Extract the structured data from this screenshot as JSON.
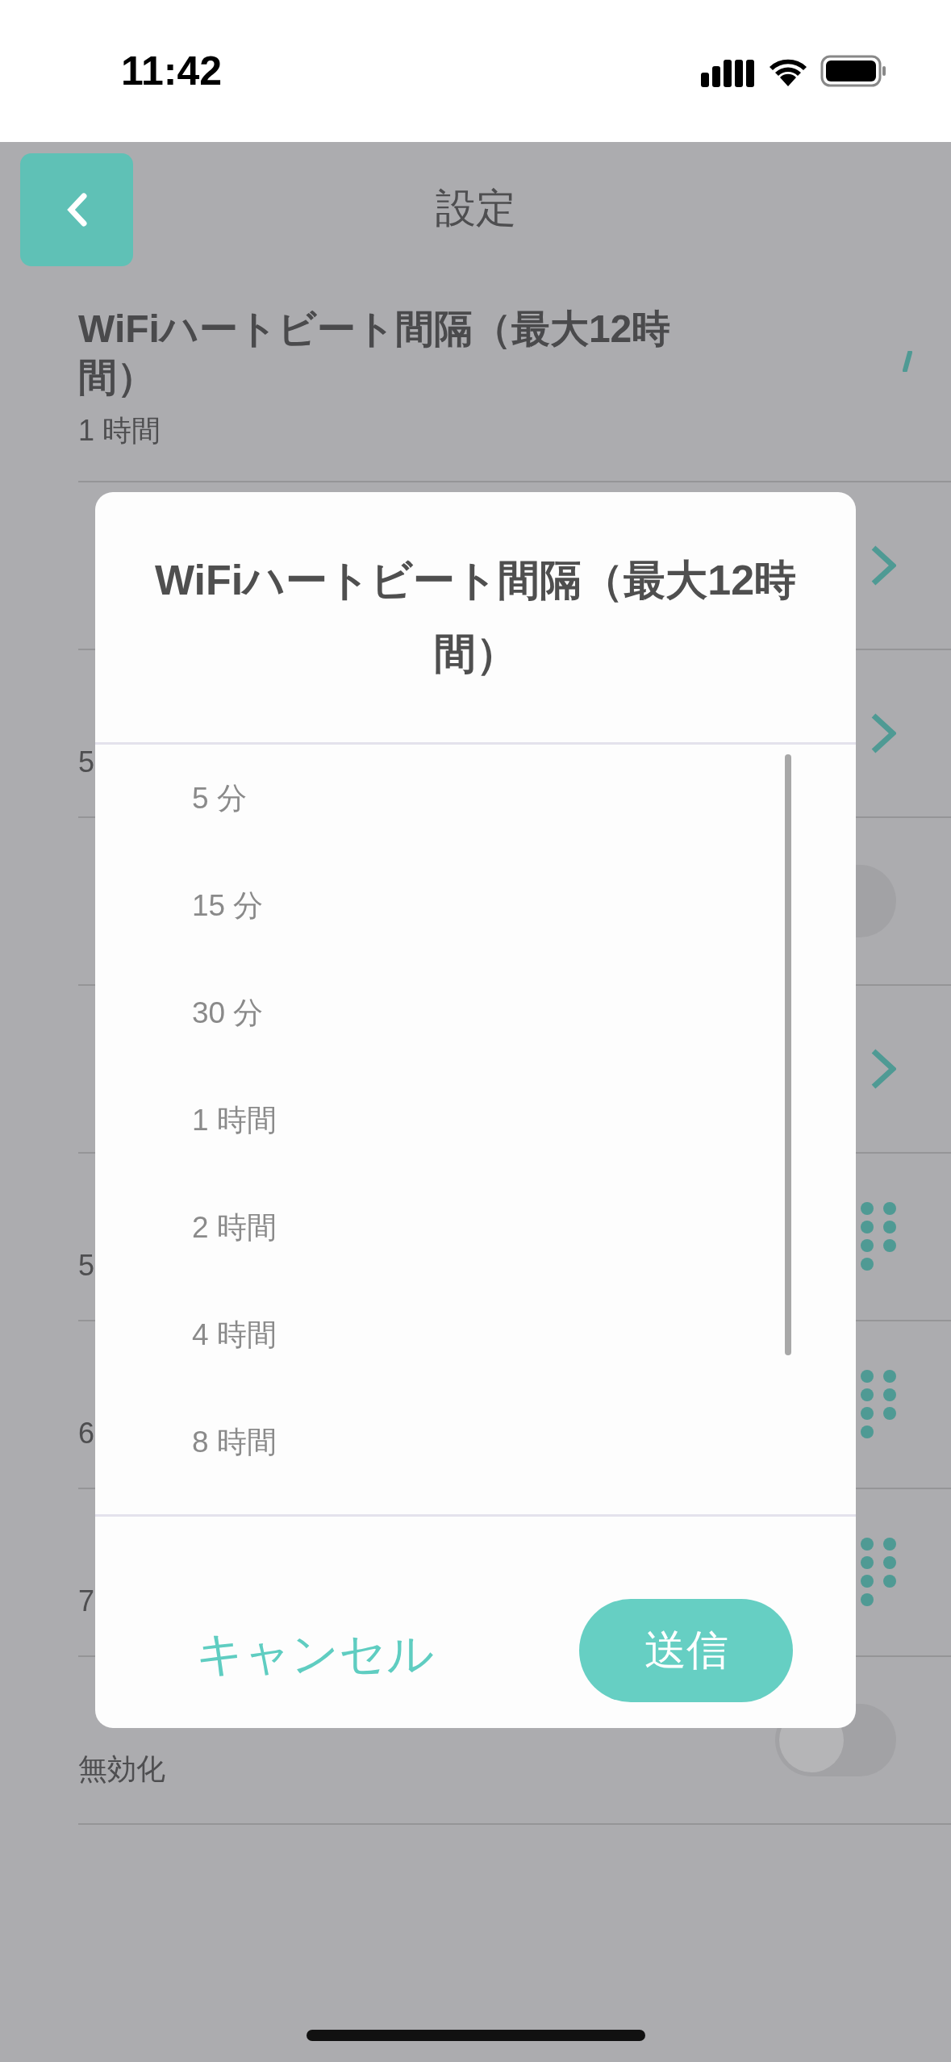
{
  "status_bar": {
    "time": "11:42"
  },
  "header": {
    "title": "設定"
  },
  "settings": [
    {
      "title": "WiFiハートビート間隔（最大12時間）",
      "value": "1 時間",
      "kind": "spinner"
    },
    {
      "kind": "chevron"
    },
    {
      "value": "5",
      "kind": "chevron"
    },
    {
      "kind": "toggle",
      "on": false
    },
    {
      "kind": "chevron"
    },
    {
      "value": "5",
      "kind": "dots"
    },
    {
      "value": "6",
      "kind": "dots"
    },
    {
      "value": "7",
      "kind": "dots"
    },
    {
      "value": "無効化",
      "kind": "toggle",
      "on": false
    }
  ],
  "dialog": {
    "title": "WiFiハートビート間隔（最大12時間）",
    "options": [
      {
        "label": "5 分"
      },
      {
        "label": "15 分"
      },
      {
        "label": "30 分"
      },
      {
        "label": "1 時間"
      },
      {
        "label": "2 時間"
      },
      {
        "label": "4 時間"
      },
      {
        "label": "8 時間"
      }
    ],
    "buttons": [
      {
        "label": "キャンセル",
        "kind": "text"
      },
      {
        "label": "送信",
        "kind": "filled"
      }
    ]
  }
}
